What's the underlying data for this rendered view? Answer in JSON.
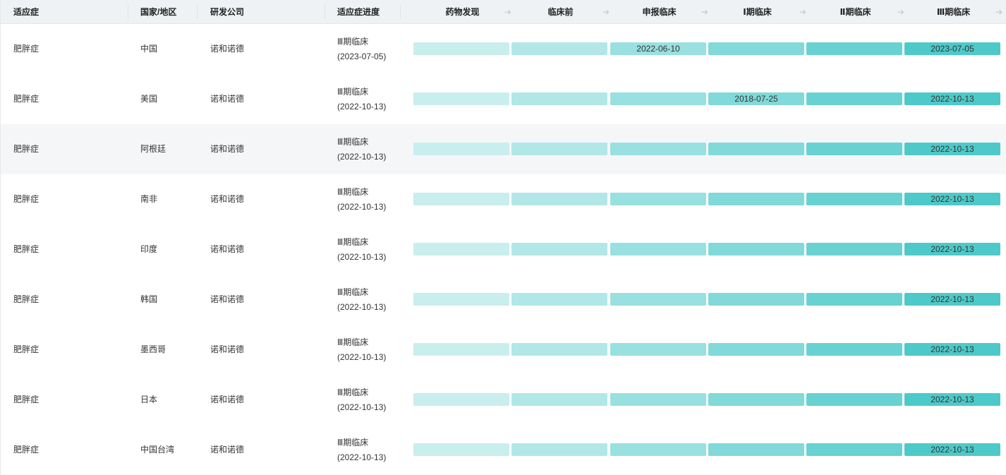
{
  "headers": {
    "indication": "适应症",
    "country": "国家/地区",
    "company": "研发公司",
    "progress": "适应症进度"
  },
  "stages": [
    "药物发现",
    "临床前",
    "申报临床",
    "Ⅰ期临床",
    "Ⅱ期临床",
    "Ⅲ期临床"
  ],
  "stage_colors": [
    "#c9eeee",
    "#b2e7e7",
    "#99e0e0",
    "#81d9d9",
    "#68d2d2",
    "#4ec9c9"
  ],
  "rows": [
    {
      "indication": "肥胖症",
      "country": "中国",
      "company": "诺和诺德",
      "progress_stage": "Ⅲ期临床",
      "progress_date": "(2023-07-05)",
      "dates": [
        "",
        "",
        "2022-06-10",
        "",
        "",
        "2023-07-05"
      ]
    },
    {
      "indication": "肥胖症",
      "country": "美国",
      "company": "诺和诺德",
      "progress_stage": "Ⅲ期临床",
      "progress_date": "(2022-10-13)",
      "dates": [
        "",
        "",
        "",
        "2018-07-25",
        "",
        "2022-10-13"
      ]
    },
    {
      "indication": "肥胖症",
      "country": "阿根廷",
      "company": "诺和诺德",
      "progress_stage": "Ⅲ期临床",
      "progress_date": "(2022-10-13)",
      "dates": [
        "",
        "",
        "",
        "",
        "",
        "2022-10-13"
      ]
    },
    {
      "indication": "肥胖症",
      "country": "南非",
      "company": "诺和诺德",
      "progress_stage": "Ⅲ期临床",
      "progress_date": "(2022-10-13)",
      "dates": [
        "",
        "",
        "",
        "",
        "",
        "2022-10-13"
      ]
    },
    {
      "indication": "肥胖症",
      "country": "印度",
      "company": "诺和诺德",
      "progress_stage": "Ⅲ期临床",
      "progress_date": "(2022-10-13)",
      "dates": [
        "",
        "",
        "",
        "",
        "",
        "2022-10-13"
      ]
    },
    {
      "indication": "肥胖症",
      "country": "韩国",
      "company": "诺和诺德",
      "progress_stage": "Ⅲ期临床",
      "progress_date": "(2022-10-13)",
      "dates": [
        "",
        "",
        "",
        "",
        "",
        "2022-10-13"
      ]
    },
    {
      "indication": "肥胖症",
      "country": "墨西哥",
      "company": "诺和诺德",
      "progress_stage": "Ⅲ期临床",
      "progress_date": "(2022-10-13)",
      "dates": [
        "",
        "",
        "",
        "",
        "",
        "2022-10-13"
      ]
    },
    {
      "indication": "肥胖症",
      "country": "日本",
      "company": "诺和诺德",
      "progress_stage": "Ⅲ期临床",
      "progress_date": "(2022-10-13)",
      "dates": [
        "",
        "",
        "",
        "",
        "",
        "2022-10-13"
      ]
    },
    {
      "indication": "肥胖症",
      "country": "中国台湾",
      "company": "诺和诺德",
      "progress_stage": "Ⅲ期临床",
      "progress_date": "(2022-10-13)",
      "dates": [
        "",
        "",
        "",
        "",
        "",
        "2022-10-13"
      ]
    }
  ]
}
